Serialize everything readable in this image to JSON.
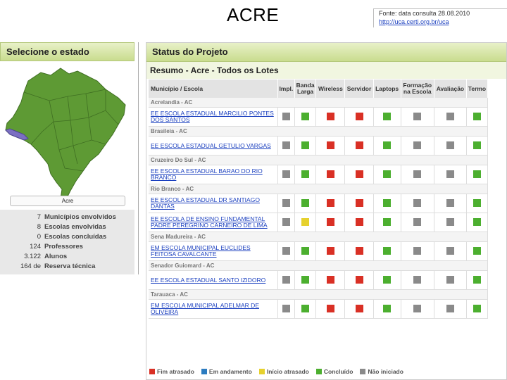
{
  "slide_title": "ACRE",
  "source": {
    "text": "Fonte: data consulta 28.08.2010",
    "link": "http://uca.certi.org.br/uca"
  },
  "left_panel": {
    "title": "Selecione o estado",
    "selected_state": "Acre",
    "stats": [
      {
        "value": "7",
        "label": "Municípios envolvidos"
      },
      {
        "value": "8",
        "label": "Escolas envolvidas"
      },
      {
        "value": "0",
        "label": "Escolas concluídas"
      },
      {
        "value": "124",
        "label": "Professores"
      },
      {
        "value": "3.122",
        "label": "Alunos"
      },
      {
        "value": "164 de",
        "label": "Reserva técnica"
      }
    ]
  },
  "right_panel": {
    "title": "Status do Projeto",
    "subtitle": "Resumo - Acre - Todos os Lotes",
    "columns": {
      "muni": "Município / Escola",
      "impl": "Impl.",
      "banda_1": "Banda",
      "banda_2": "Larga",
      "wireless": "Wireless",
      "servidor": "Servidor",
      "laptops": "Laptops",
      "formacao_1": "Formação",
      "formacao_2": "na Escola",
      "avaliacao": "Avaliação",
      "termo": "Termo"
    },
    "groups": [
      {
        "city": "Acrelandia - AC",
        "schools": [
          {
            "name": "EE ESCOLA ESTADUAL MARCILIO PONTES DOS SANTOS",
            "status": [
              "gray",
              "green",
              "red",
              "red",
              "green",
              "gray",
              "gray",
              "green"
            ]
          }
        ]
      },
      {
        "city": "Brasileia - AC",
        "schools": [
          {
            "name": "EE ESCOLA ESTADUAL GETULIO VARGAS",
            "status": [
              "gray",
              "green",
              "red",
              "red",
              "green",
              "gray",
              "gray",
              "green"
            ]
          }
        ]
      },
      {
        "city": "Cruzeiro Do Sul - AC",
        "schools": [
          {
            "name": "EE ESCOLA ESTADUAL BARAO DO RIO BRANCO",
            "status": [
              "gray",
              "green",
              "red",
              "red",
              "green",
              "gray",
              "gray",
              "green"
            ]
          }
        ]
      },
      {
        "city": "Rio Branco - AC",
        "schools": [
          {
            "name": "EE ESCOLA ESTADUAL DR SANTIAGO DANTAS",
            "status": [
              "gray",
              "green",
              "red",
              "red",
              "green",
              "gray",
              "gray",
              "green"
            ]
          },
          {
            "name": "EE ESCOLA DE ENSINO FUNDAMENTAL PADRE PEREGRINO CARNEIRO DE LIMA",
            "status": [
              "gray",
              "yellow",
              "red",
              "red",
              "green",
              "gray",
              "gray",
              "green"
            ]
          }
        ]
      },
      {
        "city": "Sena Madureira - AC",
        "schools": [
          {
            "name": "EM ESCOLA MUNICIPAL EUCLIDES FEITOSA CAVALCANTE",
            "status": [
              "gray",
              "green",
              "red",
              "red",
              "green",
              "gray",
              "gray",
              "green"
            ]
          }
        ]
      },
      {
        "city": "Senador Guiomard - AC",
        "schools": [
          {
            "name": "EE ESCOLA ESTADUAL SANTO IZIDORO",
            "status": [
              "gray",
              "green",
              "red",
              "red",
              "green",
              "gray",
              "gray",
              "green"
            ]
          }
        ]
      },
      {
        "city": "Tarauaca - AC",
        "schools": [
          {
            "name": "EM ESCOLA MUNICIPAL ADELMAR DE OLIVEIRA",
            "status": [
              "gray",
              "green",
              "red",
              "red",
              "green",
              "gray",
              "gray",
              "green"
            ]
          }
        ]
      }
    ],
    "legend": [
      {
        "label": "Fim atrasado",
        "color": "#d93025"
      },
      {
        "label": "Em andamento",
        "color": "#2c7cc0"
      },
      {
        "label": "Início atrasado",
        "color": "#e6d12e"
      },
      {
        "label": "Concluído",
        "color": "#4caf2f"
      },
      {
        "label": "Não iniciado",
        "color": "#8a8a8a"
      }
    ]
  },
  "colors": {
    "header_green": "#c9dc8e",
    "map_green": "#5e9a34",
    "acre_highlight": "#7b6fc2"
  }
}
